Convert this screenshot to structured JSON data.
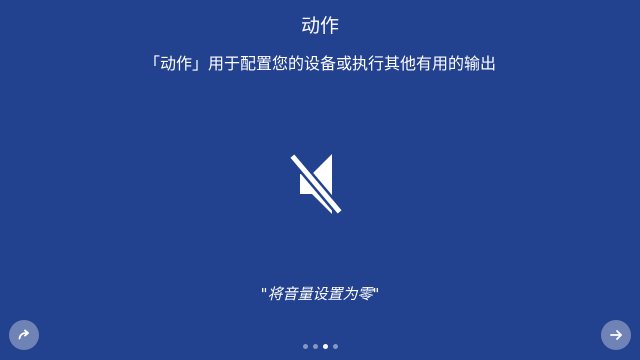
{
  "header": {
    "title": "动作",
    "subtitle": "「动作」用于配置您的设备或执行其他有用的输出"
  },
  "hero": {
    "icon": "volume-off-icon",
    "quote": "\"将音量设置为零\""
  },
  "navigation": {
    "prev_icon": "redo-arrow-icon",
    "next_icon": "arrow-right-icon",
    "page_count": 4,
    "active_page": 3
  },
  "colors": {
    "background": "#22418f",
    "foreground": "#ffffff",
    "button_fill": "rgba(255,255,255,0.35)"
  }
}
